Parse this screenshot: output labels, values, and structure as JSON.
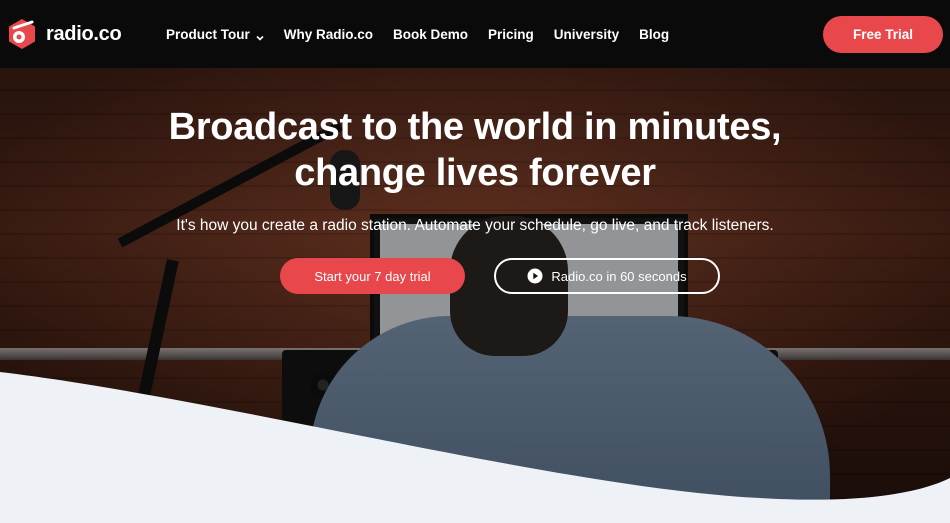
{
  "brand": {
    "name": "radio.co",
    "accent": "#e8484c"
  },
  "nav": {
    "items": [
      {
        "label": "Product Tour",
        "has_dropdown": true
      },
      {
        "label": "Why Radio.co"
      },
      {
        "label": "Book Demo"
      },
      {
        "label": "Pricing"
      },
      {
        "label": "University"
      },
      {
        "label": "Blog"
      }
    ],
    "cta": "Free Trial"
  },
  "hero": {
    "headline_line1": "Broadcast to the world in minutes,",
    "headline_line2": "change lives forever",
    "subtitle": "It's how you create a radio station. Automate your schedule, go live, and track listeners.",
    "primary_button": "Start your 7 day trial",
    "secondary_button": "Radio.co in 60 seconds",
    "secondary_icon": "play-circle-icon"
  }
}
